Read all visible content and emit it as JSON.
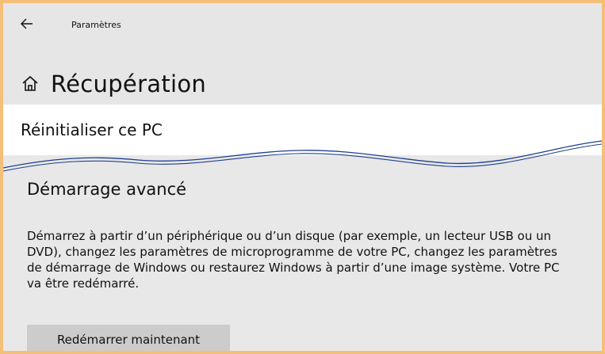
{
  "window": {
    "title": "Paramètres",
    "back_icon": "back-arrow-icon"
  },
  "page": {
    "title": "Récupération",
    "icon": "home-icon"
  },
  "sections": {
    "reset_title": "Réinitialiser ce PC",
    "advanced_title": "Démarrage avancé",
    "advanced_description": "Démarrez à partir d’un périphérique ou d’un disque (par exemple, un lecteur USB ou un DVD), changez les paramètres de microprogramme de votre PC, changez les paramètres de démarrage de Windows ou restaurez Windows à partir d’une image système. Votre PC va être redémarré.",
    "restart_button": "Redémarrer maintenant"
  },
  "colors": {
    "border": "#f3c07a",
    "background": "#e8e8e8",
    "band": "#ffffff",
    "button": "#cccccc",
    "wave": "#1f3f8f"
  }
}
